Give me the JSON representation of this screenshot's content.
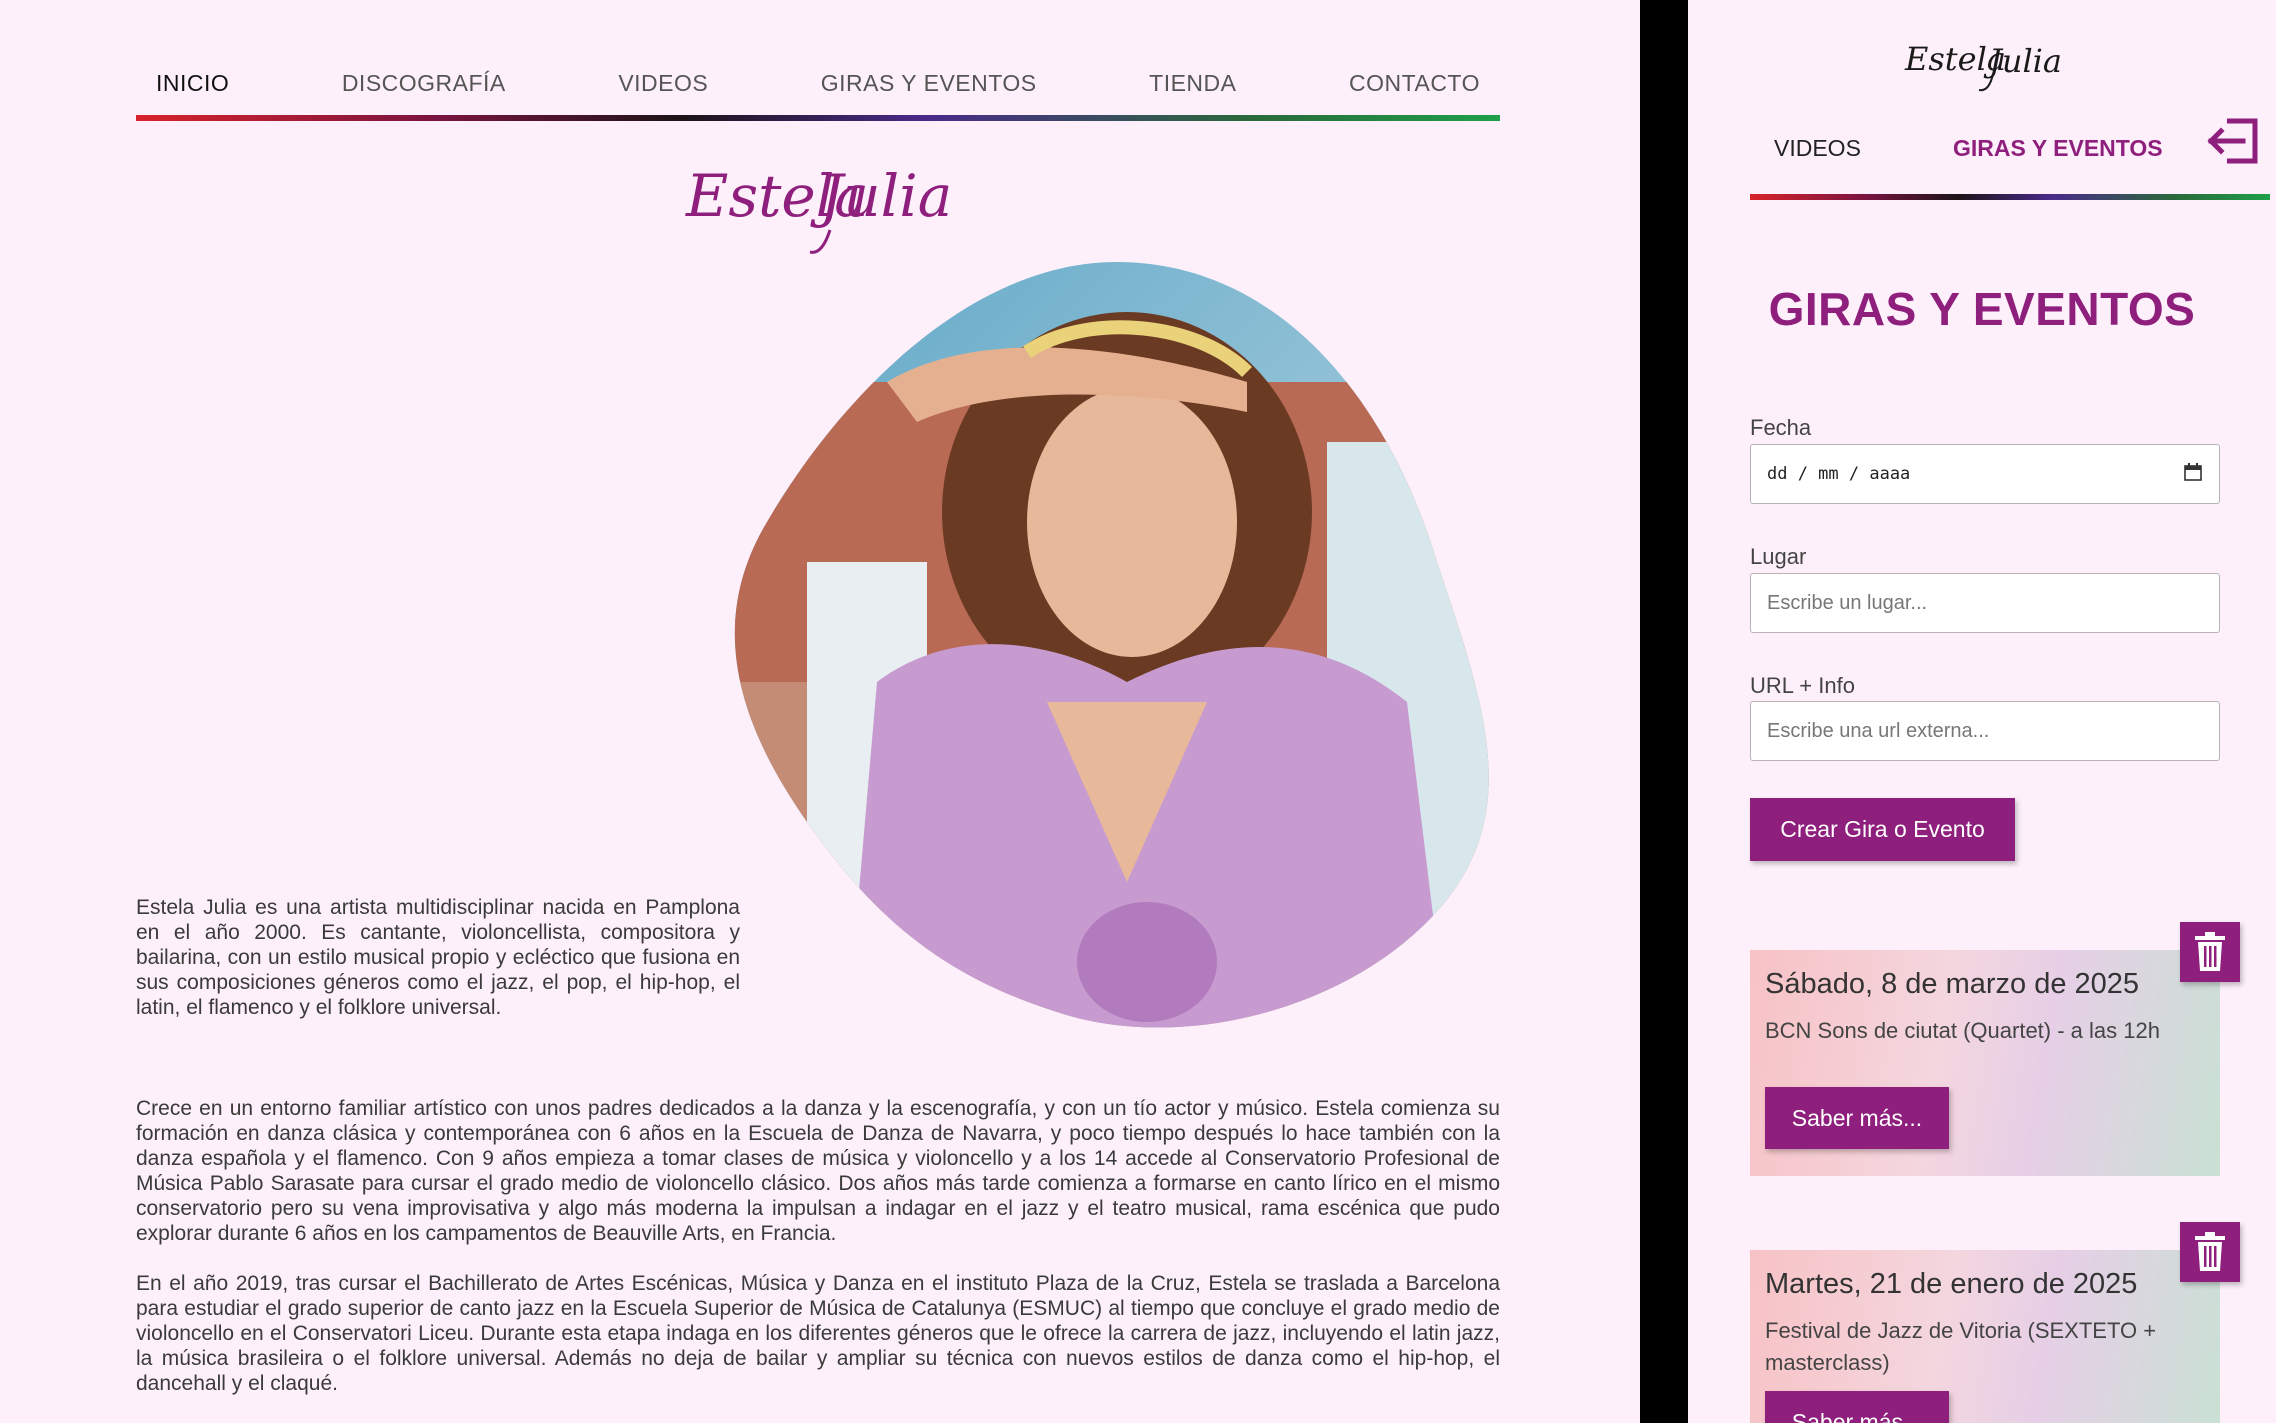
{
  "nav": {
    "items": [
      {
        "label": "INICIO"
      },
      {
        "label": "DISCOGRAFÍA"
      },
      {
        "label": "VIDEOS"
      },
      {
        "label": "GIRAS Y EVENTOS"
      },
      {
        "label": "TIENDA"
      },
      {
        "label": "CONTACTO"
      }
    ],
    "active": "INICIO"
  },
  "brand": {
    "logo_text": "Estela Julia",
    "color": "#8e1f7d"
  },
  "bio": {
    "intro": "Estela Julia es una artista multidisciplinar nacida en Pamplona en el año 2000. Es cantante, violoncellista, compositora y bailarina, con un estilo musical propio y ecléctico que fusiona en sus composiciones géneros como el jazz, el pop, el hip-hop, el latin, el flamenco y el folklore universal.",
    "p2": "Crece en un entorno familiar artístico con unos padres dedicados a la danza y la escenografía, y con un tío actor y músico. Estela comienza su formación en danza clásica y contemporánea con 6 años en la Escuela de Danza de Navarra, y poco tiempo después lo hace también con la danza española y el flamenco. Con 9 años empieza a tomar clases de música y violoncello y a los 14 accede al Conservatorio Profesional de Música Pablo Sarasate para cursar el grado medio de violoncello clásico. Dos años más tarde comienza a formarse en canto lírico en el mismo conservatorio pero su vena improvisativa y algo más moderna la impulsan a indagar en el jazz y el teatro musical, rama escénica que pudo explorar durante 6 años en los campamentos de Beauville Arts, en Francia.",
    "p3": "En el año 2019, tras cursar el Bachillerato de Artes Escénicas, Música y Danza en el instituto Plaza de la Cruz, Estela se traslada a Barcelona para estudiar el grado superior de canto jazz en la Escuela Superior de Música de Catalunya (ESMUC) al tiempo que concluye el grado medio de violoncello en el Conservatori Liceu. Durante esta etapa indaga en los diferentes géneros que le ofrece la carrera de jazz, incluyendo el latin jazz, la música brasileira o el folklore universal. Además no deja de bailar y ampliar su técnica con nuevos estilos de danza como el hip-hop, el dancehall y el claqué."
  },
  "admin": {
    "nav_videos": "VIDEOS",
    "nav_giras": "GIRAS Y EVENTOS",
    "title": "GIRAS Y EVENTOS",
    "form": {
      "fecha_label": "Fecha",
      "fecha_placeholder": "dd / mm / aaaa",
      "lugar_label": "Lugar",
      "lugar_placeholder": "Escribe un lugar...",
      "url_label": "URL + Info",
      "url_placeholder": "Escribe una url externa...",
      "submit_label": "Crear Gira o Evento"
    },
    "events": [
      {
        "date": "Sábado, 8 de marzo de 2025",
        "desc": "BCN Sons de ciutat (Quartet) - a las 12h",
        "button": "Saber más..."
      },
      {
        "date": "Martes, 21 de enero de 2025",
        "desc": "Festival de Jazz de Vitoria (SEXTETO + masterclass)",
        "button": "Saber más..."
      }
    ]
  },
  "icons": [
    "calendar-icon",
    "logout-icon",
    "trash-icon"
  ],
  "colors": {
    "accent": "#8e1f7d",
    "background": "#fdf0fb"
  }
}
